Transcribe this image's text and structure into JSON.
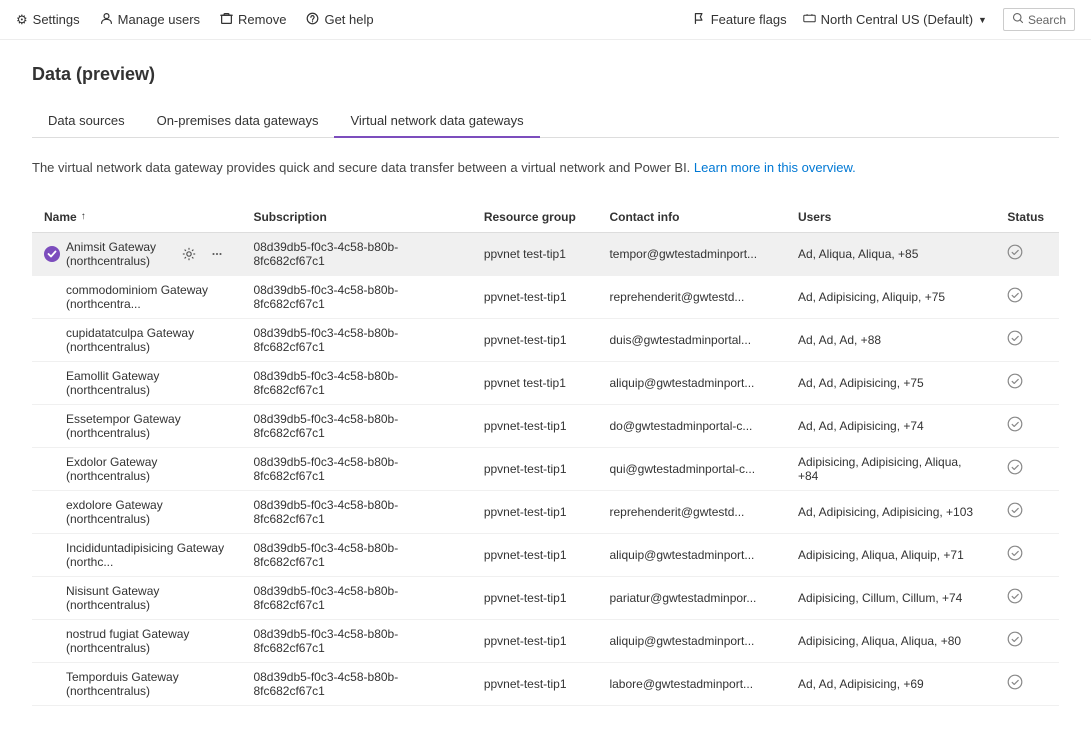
{
  "topNav": {
    "items": [
      {
        "id": "settings",
        "label": "Settings",
        "icon": "⚙"
      },
      {
        "id": "manage-users",
        "label": "Manage users",
        "icon": "👤"
      },
      {
        "id": "remove",
        "label": "Remove",
        "icon": "🗑"
      },
      {
        "id": "get-help",
        "label": "Get help",
        "icon": "?"
      }
    ],
    "right": [
      {
        "id": "feature-flags",
        "label": "Feature flags",
        "icon": "🚩"
      },
      {
        "id": "region",
        "label": "North Central US (Default)",
        "icon": "🌐"
      },
      {
        "id": "search",
        "label": "Search",
        "icon": "🔍"
      }
    ]
  },
  "page": {
    "title": "Data (preview)"
  },
  "tabs": [
    {
      "id": "data-sources",
      "label": "Data sources",
      "active": false
    },
    {
      "id": "on-premises",
      "label": "On-premises data gateways",
      "active": false
    },
    {
      "id": "virtual-network",
      "label": "Virtual network data gateways",
      "active": true
    }
  ],
  "description": {
    "text": "The virtual network data gateway provides quick and secure data transfer between a virtual network and Power BI.",
    "linkText": "Learn more in this overview.",
    "linkHref": "#"
  },
  "table": {
    "columns": [
      {
        "id": "name",
        "label": "Name",
        "sortable": true,
        "sortDir": "asc"
      },
      {
        "id": "subscription",
        "label": "Subscription",
        "sortable": false
      },
      {
        "id": "resource-group",
        "label": "Resource group",
        "sortable": false
      },
      {
        "id": "contact-info",
        "label": "Contact info",
        "sortable": false
      },
      {
        "id": "users",
        "label": "Users",
        "sortable": false
      },
      {
        "id": "status",
        "label": "Status",
        "sortable": false
      }
    ],
    "rows": [
      {
        "id": "animsit",
        "selected": true,
        "name": "Animsit Gateway (northcentralus)",
        "subscription": "08d39db5-f0c3-4c58-b80b-8fc682cf67c1",
        "resourceGroup": "ppvnet test-tip1",
        "contactInfo": "tempor@gwtestadminport...",
        "users": "Ad, Aliqua, Aliqua, +85",
        "status": "ok"
      },
      {
        "id": "commodominiom",
        "selected": false,
        "name": "commodominiom Gateway (northcentra...",
        "subscription": "08d39db5-f0c3-4c58-b80b-8fc682cf67c1",
        "resourceGroup": "ppvnet-test-tip1",
        "contactInfo": "reprehenderit@gwtestd...",
        "users": "Ad, Adipisicing, Aliquip, +75",
        "status": "ok"
      },
      {
        "id": "cupidatatculpa",
        "selected": false,
        "name": "cupidatatculpa Gateway (northcentralus)",
        "subscription": "08d39db5-f0c3-4c58-b80b-8fc682cf67c1",
        "resourceGroup": "ppvnet-test-tip1",
        "contactInfo": "duis@gwtestadminportal...",
        "users": "Ad, Ad, Ad, +88",
        "status": "ok"
      },
      {
        "id": "eamollit",
        "selected": false,
        "name": "Eamollit Gateway (northcentralus)",
        "subscription": "08d39db5-f0c3-4c58-b80b-8fc682cf67c1",
        "resourceGroup": "ppvnet test-tip1",
        "contactInfo": "aliquip@gwtestadminport...",
        "users": "Ad, Ad, Adipisicing, +75",
        "status": "ok"
      },
      {
        "id": "essetempor",
        "selected": false,
        "name": "Essetempor Gateway (northcentralus)",
        "subscription": "08d39db5-f0c3-4c58-b80b-8fc682cf67c1",
        "resourceGroup": "ppvnet-test-tip1",
        "contactInfo": "do@gwtestadminportal-c...",
        "users": "Ad, Ad, Adipisicing, +74",
        "status": "ok"
      },
      {
        "id": "exdolor",
        "selected": false,
        "name": "Exdolor Gateway (northcentralus)",
        "subscription": "08d39db5-f0c3-4c58-b80b-8fc682cf67c1",
        "resourceGroup": "ppvnet-test-tip1",
        "contactInfo": "qui@gwtestadminportal-c...",
        "users": "Adipisicing, Adipisicing, Aliqua, +84",
        "status": "ok"
      },
      {
        "id": "exdolore",
        "selected": false,
        "name": "exdolore Gateway (northcentralus)",
        "subscription": "08d39db5-f0c3-4c58-b80b-8fc682cf67c1",
        "resourceGroup": "ppvnet-test-tip1",
        "contactInfo": "reprehenderit@gwtestd...",
        "users": "Ad, Adipisicing, Adipisicing, +103",
        "status": "ok"
      },
      {
        "id": "incididuntadipisicing",
        "selected": false,
        "name": "Incididuntadipisicing Gateway (northc...",
        "subscription": "08d39db5-f0c3-4c58-b80b-8fc682cf67c1",
        "resourceGroup": "ppvnet-test-tip1",
        "contactInfo": "aliquip@gwtestadminport...",
        "users": "Adipisicing, Aliqua, Aliquip, +71",
        "status": "ok"
      },
      {
        "id": "nisisunt",
        "selected": false,
        "name": "Nisisunt Gateway (northcentralus)",
        "subscription": "08d39db5-f0c3-4c58-b80b-8fc682cf67c1",
        "resourceGroup": "ppvnet-test-tip1",
        "contactInfo": "pariatur@gwtestadminpor...",
        "users": "Adipisicing, Cillum, Cillum, +74",
        "status": "ok"
      },
      {
        "id": "nostrud",
        "selected": false,
        "name": "nostrud fugiat Gateway (northcentralus)",
        "subscription": "08d39db5-f0c3-4c58-b80b-8fc682cf67c1",
        "resourceGroup": "ppvnet-test-tip1",
        "contactInfo": "aliquip@gwtestadminport...",
        "users": "Adipisicing, Aliqua, Aliqua, +80",
        "status": "ok"
      },
      {
        "id": "temporduis",
        "selected": false,
        "name": "Temporduis Gateway (northcentralus)",
        "subscription": "08d39db5-f0c3-4c58-b80b-8fc682cf67c1",
        "resourceGroup": "ppvnet-test-tip1",
        "contactInfo": "labore@gwtestadminport...",
        "users": "Ad, Ad, Adipisicing, +69",
        "status": "ok"
      }
    ]
  }
}
